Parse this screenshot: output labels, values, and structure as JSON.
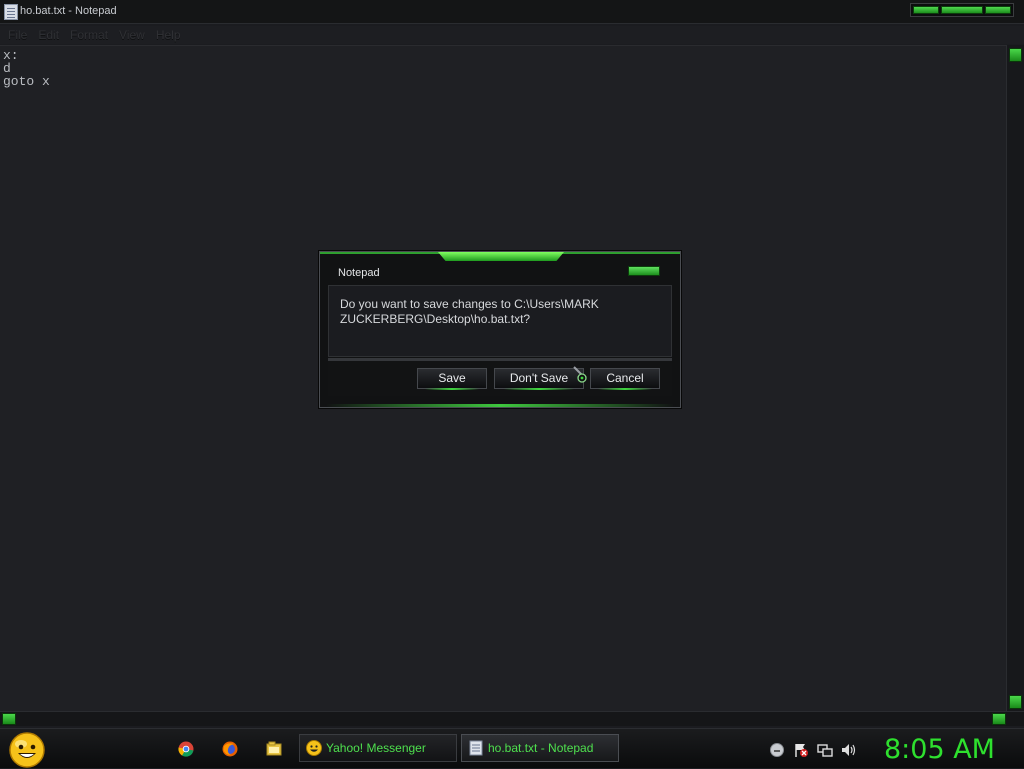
{
  "window": {
    "title": "ho.bat.txt - Notepad"
  },
  "menubar": {
    "items": [
      "File",
      "Edit",
      "Format",
      "View",
      "Help"
    ]
  },
  "editor": {
    "lines": [
      "x:",
      "d",
      "goto x"
    ]
  },
  "dialog": {
    "title": "Notepad",
    "message": "Do you want to save changes to C:\\Users\\MARK ZUCKERBERG\\Desktop\\ho.bat.txt?",
    "buttons": {
      "save": "Save",
      "dont_save": "Don't Save",
      "cancel": "Cancel"
    }
  },
  "taskbar": {
    "tasks": [
      {
        "label": "Yahoo! Messenger",
        "icon": "yahoo-messenger-icon"
      },
      {
        "label": "ho.bat.txt - Notepad",
        "icon": "notepad-icon"
      }
    ],
    "quick_launch": [
      "chrome-icon",
      "firefox-icon",
      "folder-icon"
    ],
    "tray": [
      "messenger-status-icon",
      "action-center-flag-icon",
      "network-icon",
      "volume-icon"
    ],
    "clock": "8:05 AM"
  },
  "colors": {
    "accent": "#3ede3e",
    "clock": "#2ee02e",
    "background": "#1f2024"
  }
}
